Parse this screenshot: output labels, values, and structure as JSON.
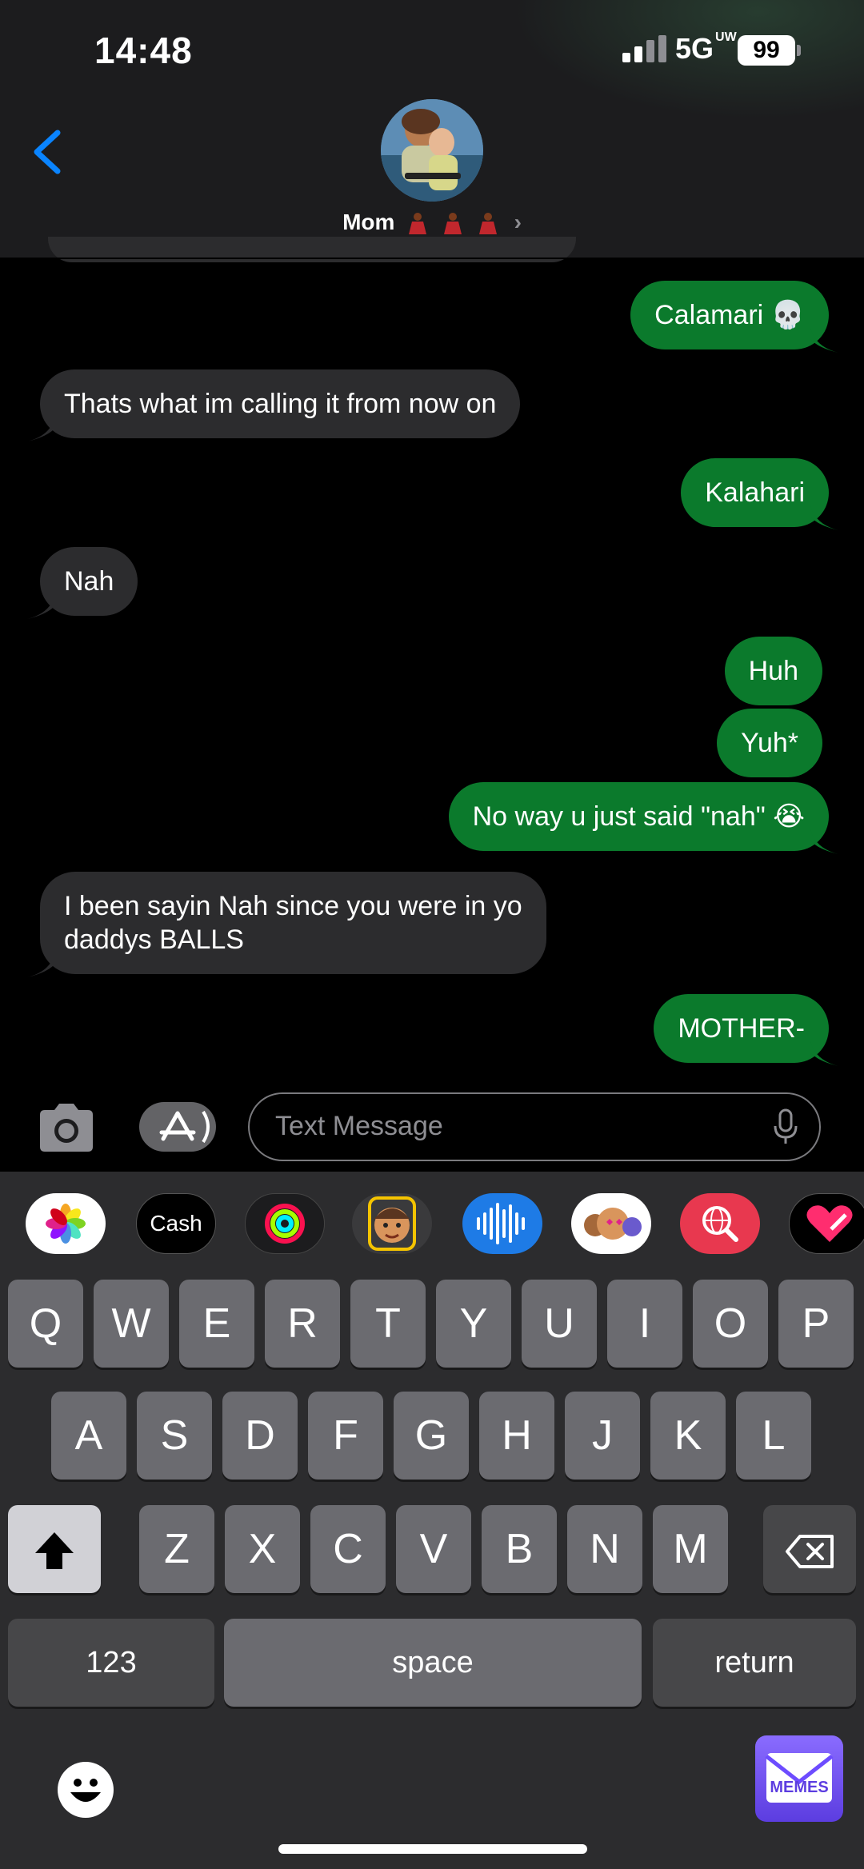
{
  "status_bar": {
    "time": "14:48",
    "network": "5G",
    "network_suffix": "UW",
    "battery": "99"
  },
  "header": {
    "contact_name": "Mom",
    "emoji_icon": "dancing-woman-emoji"
  },
  "messages": [
    {
      "from": "me",
      "text": "Calamari 💀"
    },
    {
      "from": "them",
      "text": "Thats what im calling it from now on"
    },
    {
      "from": "me",
      "text": "Kalahari"
    },
    {
      "from": "them",
      "text": "Nah"
    },
    {
      "from": "me",
      "text": "Huh"
    },
    {
      "from": "me",
      "text": "Yuh*"
    },
    {
      "from": "me",
      "text": "No way u just said \"nah\" 😭"
    },
    {
      "from": "them",
      "text": "I been sayin Nah since you were in yo\ndaddys BALLS"
    },
    {
      "from": "me",
      "text": "MOTHER-"
    }
  ],
  "compose": {
    "placeholder": "Text Message"
  },
  "apps": [
    {
      "name": "photos-app-icon"
    },
    {
      "name": "apple-cash-app-icon",
      "label": "Cash"
    },
    {
      "name": "activity-app-icon"
    },
    {
      "name": "memoji-app-icon"
    },
    {
      "name": "audio-message-app-icon"
    },
    {
      "name": "memoji-stickers-app-icon"
    },
    {
      "name": "images-search-app-icon"
    },
    {
      "name": "heart-sticker-app-icon"
    }
  ],
  "keyboard": {
    "row1": [
      "Q",
      "W",
      "E",
      "R",
      "T",
      "Y",
      "U",
      "I",
      "O",
      "P"
    ],
    "row2": [
      "A",
      "S",
      "D",
      "F",
      "G",
      "H",
      "J",
      "K",
      "L"
    ],
    "row3": [
      "Z",
      "X",
      "C",
      "V",
      "B",
      "N",
      "M"
    ],
    "numbers_label": "123",
    "space_label": "space",
    "return_label": "return",
    "memes_label": "MEMES"
  },
  "colors": {
    "sent_bubble": "#0b7a2c",
    "received_bubble": "#2c2c2e",
    "accent": "#0a84ff"
  }
}
